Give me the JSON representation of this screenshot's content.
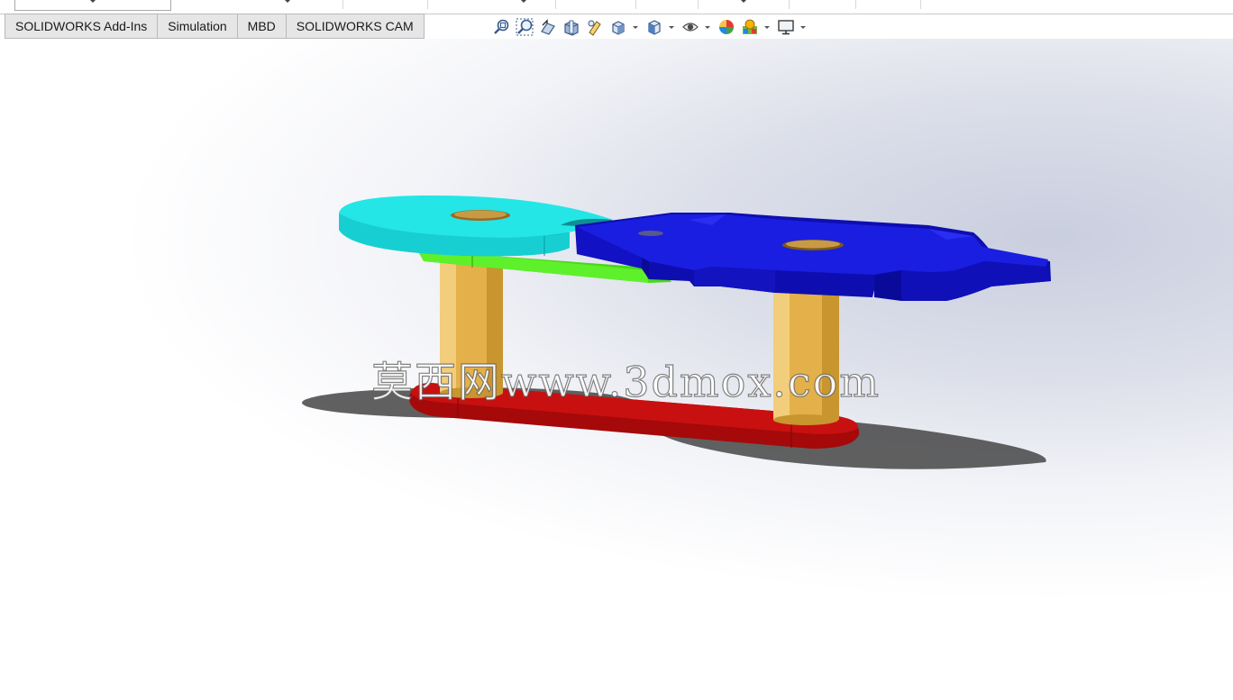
{
  "ribbon_tabs": [
    {
      "label": "SOLIDWORKS Add-Ins"
    },
    {
      "label": "Simulation"
    },
    {
      "label": "MBD"
    },
    {
      "label": "SOLIDWORKS CAM"
    }
  ],
  "view_toolbar": {
    "icons": [
      "zoom-to-fit-icon",
      "zoom-to-area-icon",
      "previous-view-icon",
      "section-view-icon",
      "dynamic-annotation-icon",
      "view-orientation-icon",
      "display-style-icon",
      "hide-show-items-icon",
      "edit-appearance-icon",
      "apply-scene-icon",
      "view-settings-icon"
    ]
  },
  "model": {
    "part_colors": {
      "cam_disk": "#19d9d9",
      "follower_link": "#55ee22",
      "geneva_wheel": "#1414d6",
      "posts": "#e8b84f",
      "base_link": "#c40d0d"
    }
  },
  "watermark": {
    "text": "莫西网www.3dmox.com"
  }
}
